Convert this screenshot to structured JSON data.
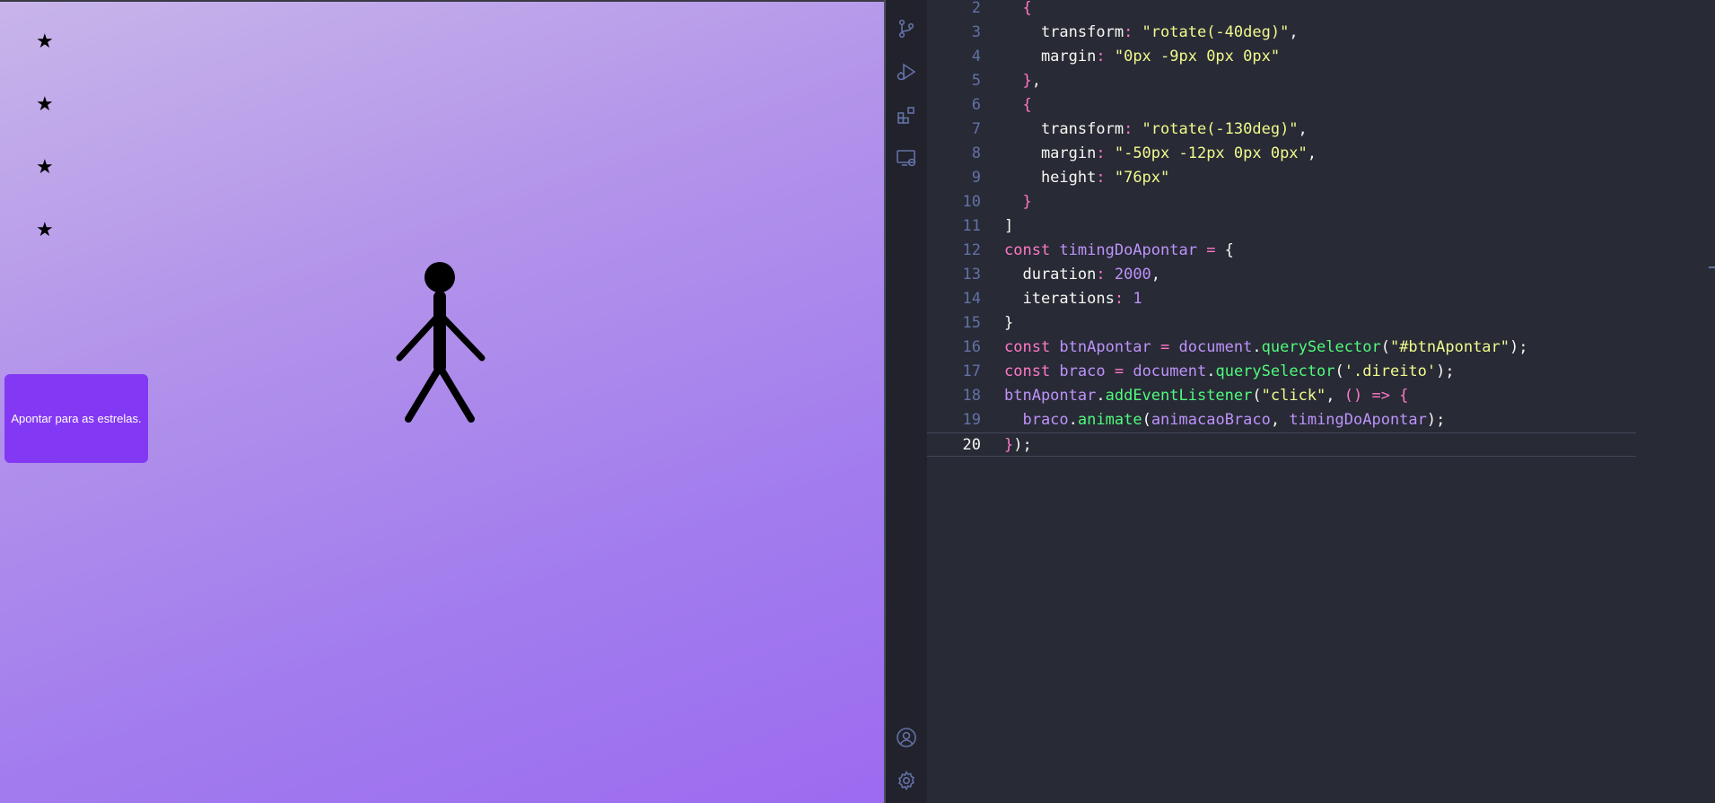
{
  "preview": {
    "stars": [
      "★",
      "★",
      "★",
      "★"
    ],
    "button_label": "Apontar para as estrelas.",
    "colors": {
      "button": "#8338f4",
      "gradient_start": "#c8b5ea",
      "gradient_end": "#9c6bf0"
    }
  },
  "activity_bar": {
    "icons": [
      "source-control-icon",
      "run-debug-icon",
      "extensions-icon",
      "remote-explorer-icon",
      "account-icon",
      "settings-gear-icon"
    ]
  },
  "editor": {
    "active_line": "20",
    "lines": [
      {
        "n": "2",
        "tokens": [
          [
            "  ",
            "pun"
          ],
          [
            "{",
            "kw"
          ]
        ]
      },
      {
        "n": "3",
        "tokens": [
          [
            "    transform",
            "pun"
          ],
          [
            ": ",
            "op"
          ],
          [
            "\"rotate(-40deg)\"",
            "str"
          ],
          [
            ",",
            "pun"
          ]
        ]
      },
      {
        "n": "4",
        "tokens": [
          [
            "    margin",
            "pun"
          ],
          [
            ": ",
            "op"
          ],
          [
            "\"0px -9px 0px 0px\"",
            "str"
          ]
        ]
      },
      {
        "n": "5",
        "tokens": [
          [
            "  }",
            "kw"
          ],
          [
            ",",
            "pun"
          ]
        ]
      },
      {
        "n": "6",
        "tokens": [
          [
            "  {",
            "kw"
          ]
        ]
      },
      {
        "n": "7",
        "tokens": [
          [
            "    transform",
            "pun"
          ],
          [
            ": ",
            "op"
          ],
          [
            "\"rotate(-130deg)\"",
            "str"
          ],
          [
            ",",
            "pun"
          ]
        ]
      },
      {
        "n": "8",
        "tokens": [
          [
            "    margin",
            "pun"
          ],
          [
            ": ",
            "op"
          ],
          [
            "\"-50px -12px 0px 0px\"",
            "str"
          ],
          [
            ",",
            "pun"
          ]
        ]
      },
      {
        "n": "9",
        "tokens": [
          [
            "    height",
            "pun"
          ],
          [
            ": ",
            "op"
          ],
          [
            "\"76px\"",
            "str"
          ]
        ]
      },
      {
        "n": "10",
        "tokens": [
          [
            "  }",
            "kw"
          ]
        ]
      },
      {
        "n": "11",
        "tokens": [
          [
            "]",
            "pun"
          ]
        ]
      },
      {
        "n": "12",
        "tokens": [
          [
            "const ",
            "kw"
          ],
          [
            "timingDoApontar",
            "var"
          ],
          [
            " = ",
            "op"
          ],
          [
            "{",
            "pun"
          ]
        ]
      },
      {
        "n": "13",
        "tokens": [
          [
            "  duration",
            "pun"
          ],
          [
            ": ",
            "op"
          ],
          [
            "2000",
            "num"
          ],
          [
            ",",
            "pun"
          ]
        ]
      },
      {
        "n": "14",
        "tokens": [
          [
            "  iterations",
            "pun"
          ],
          [
            ": ",
            "op"
          ],
          [
            "1",
            "num"
          ]
        ]
      },
      {
        "n": "15",
        "tokens": [
          [
            "}",
            "pun"
          ]
        ]
      },
      {
        "n": "16",
        "tokens": [
          [
            "const ",
            "kw"
          ],
          [
            "btnApontar",
            "var"
          ],
          [
            " = ",
            "op"
          ],
          [
            "document",
            "var"
          ],
          [
            ".",
            "pun"
          ],
          [
            "querySelector",
            "fn"
          ],
          [
            "(",
            "pun"
          ],
          [
            "\"#btnApontar\"",
            "str"
          ],
          [
            ");",
            "pun"
          ]
        ]
      },
      {
        "n": "17",
        "tokens": [
          [
            "const ",
            "kw"
          ],
          [
            "braco",
            "var"
          ],
          [
            " = ",
            "op"
          ],
          [
            "document",
            "var"
          ],
          [
            ".",
            "pun"
          ],
          [
            "querySelector",
            "fn"
          ],
          [
            "(",
            "pun"
          ],
          [
            "'.direito'",
            "str"
          ],
          [
            ");",
            "pun"
          ]
        ]
      },
      {
        "n": "18",
        "tokens": [
          [
            "btnApontar",
            "var"
          ],
          [
            ".",
            "pun"
          ],
          [
            "addEventListener",
            "fn"
          ],
          [
            "(",
            "pun"
          ],
          [
            "\"click\"",
            "str"
          ],
          [
            ", ",
            "pun"
          ],
          [
            "() => {",
            "kw"
          ]
        ]
      },
      {
        "n": "19",
        "tokens": [
          [
            "  braco",
            "var"
          ],
          [
            ".",
            "pun"
          ],
          [
            "animate",
            "fn"
          ],
          [
            "(",
            "pun"
          ],
          [
            "animacaoBraco",
            "var"
          ],
          [
            ", ",
            "pun"
          ],
          [
            "timingDoApontar",
            "var"
          ],
          [
            ");",
            "pun"
          ]
        ]
      },
      {
        "n": "20",
        "tokens": [
          [
            "}",
            "kw"
          ],
          [
            ");",
            "pun"
          ]
        ]
      }
    ]
  }
}
